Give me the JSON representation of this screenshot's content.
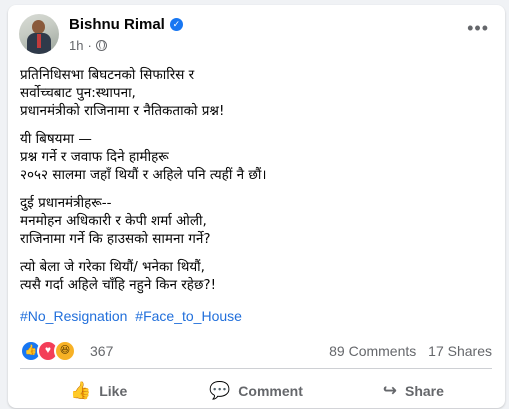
{
  "post": {
    "author": "Bishnu Rimal",
    "time": "1h",
    "separator": "·",
    "text_blocks": [
      "प्रतिनिधिसभा बिघटनको सिफारिस र\nसर्वोच्चबाट पुन:स्थापना,\nप्रधानमंत्रीको राजिनामा र नैतिकताको प्रश्न!",
      "यी बिषयमा —\nप्रश्न गर्ने र जवाफ दिने हामीहरू\n२०५२ सालमा जहाँ थियौं र अहिले पनि त्यहीं नै छौं।",
      "दुई प्रधानमंत्रीहरू--\nमनमोहन अधिकारी र केपी शर्मा ओली,\nराजिनामा गर्ने कि हाउसको सामना गर्ने?",
      "त्यो बेला जे गरेका थियौं/ भनेका थियौं,\nत्यसै गर्दा अहिले चाँहि नहुने किन रहेछ?!"
    ],
    "hashtags": [
      "#No_Resignation",
      "#Face_to_House"
    ]
  },
  "stats": {
    "reaction_count": "367",
    "comments": "89 Comments",
    "shares": "17 Shares"
  },
  "actions": {
    "like": "Like",
    "comment": "Comment",
    "share": "Share"
  },
  "icons": {
    "like": "thumbs-up-icon",
    "comment": "comment-icon",
    "share": "share-arrow-icon",
    "more": "more-options-icon"
  },
  "colors": {
    "accent": "#1877f2",
    "hashtag": "#216fdb",
    "muted": "#65676b",
    "love": "#f33e58",
    "haha": "#f7b125"
  }
}
